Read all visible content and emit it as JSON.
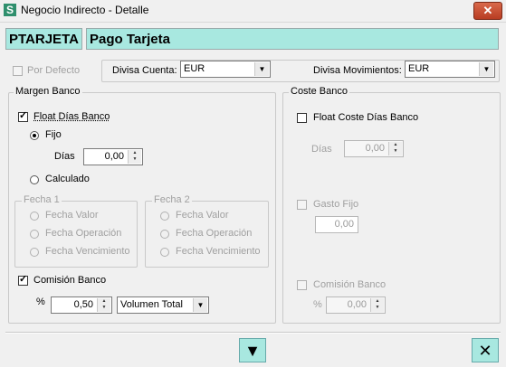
{
  "window": {
    "title": "Negocio Indirecto - Detalle",
    "close_glyph": "✕"
  },
  "header": {
    "code": "PTARJETA",
    "description": "Pago Tarjeta"
  },
  "top": {
    "por_defecto": "Por Defecto",
    "divisa_cuenta_label": "Divisa Cuenta:",
    "divisa_cuenta_value": "EUR",
    "divisa_mov_label": "Divisa Movimientos:",
    "divisa_mov_value": "EUR"
  },
  "margen": {
    "title": "Margen Banco",
    "float_label": "Float Días Banco",
    "fijo_label": "Fijo",
    "dias_label": "Días",
    "dias_value": "0,00",
    "calculado_label": "Calculado",
    "fecha1_title": "Fecha 1",
    "fecha2_title": "Fecha 2",
    "fecha_options": [
      "Fecha Valor",
      "Fecha Operación",
      "Fecha Vencimiento"
    ],
    "comision_label": "Comisión Banco",
    "pct_label": "%",
    "pct_value": "0,50",
    "volumen_value": "Volumen Total"
  },
  "coste": {
    "title": "Coste Banco",
    "float_label": "Float Coste Días Banco",
    "dias_label": "Días",
    "dias_value": "0,00",
    "gasto_label": "Gasto Fijo",
    "gasto_value": "0,00",
    "comision_label": "Comisión Banco",
    "pct_label": "%",
    "pct_value": "0,00"
  },
  "footer": {
    "down_glyph": "▼",
    "cancel_glyph": "✕"
  },
  "colors": {
    "accent": "#a8e8e0",
    "close": "#c4472b"
  }
}
